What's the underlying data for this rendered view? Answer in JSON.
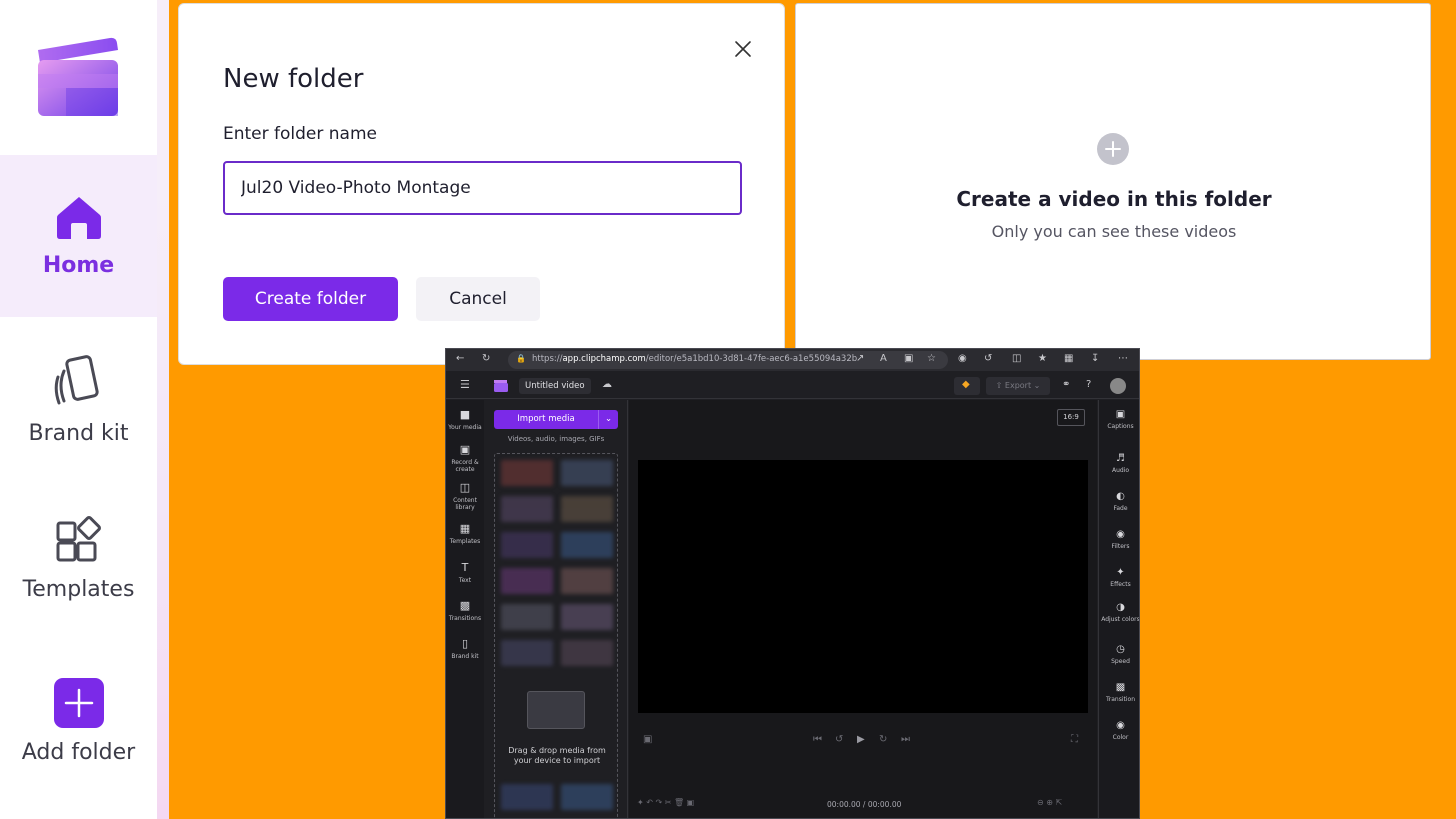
{
  "sidebar": {
    "items": [
      {
        "label": "Home",
        "icon": "home-icon",
        "active": true
      },
      {
        "label": "Brand kit",
        "icon": "brand-kit-icon"
      },
      {
        "label": "Templates",
        "icon": "templates-icon"
      },
      {
        "label": "Add folder",
        "icon": "plus-icon"
      }
    ]
  },
  "dialog": {
    "title": "New folder",
    "field_label": "Enter folder name",
    "input_value": "Jul20 Video-Photo Montage",
    "create_label": "Create folder",
    "cancel_label": "Cancel"
  },
  "folder_panel": {
    "title": "Create a video in this folder",
    "subtitle": "Only you can see these videos"
  },
  "browser": {
    "url_prefix": "https://",
    "url_host": "app.clipchamp.com",
    "url_path": "/editor/e5a1bd10-3d81-47fe-aec6-a1e55094a32b",
    "project_name": "Untitled video",
    "export_label": "Export",
    "import_label": "Import media",
    "media_sub": "Videos, audio, images, GIFs",
    "drop_text_1": "Drag & drop media from",
    "drop_text_2": "your device to import",
    "aspect_ratio": "16:9",
    "time": "00:00.00 / 00:00.00",
    "left_rail": [
      "Your media",
      "Record & create",
      "Content library",
      "Templates",
      "Text",
      "Transitions",
      "Brand kit"
    ],
    "right_rail": [
      "Captions",
      "Audio",
      "Fade",
      "Filters",
      "Effects",
      "Adjust colors",
      "Speed",
      "Transition",
      "Color"
    ]
  },
  "colors": {
    "accent": "#7b2ae8",
    "background": "#ff9a00"
  }
}
